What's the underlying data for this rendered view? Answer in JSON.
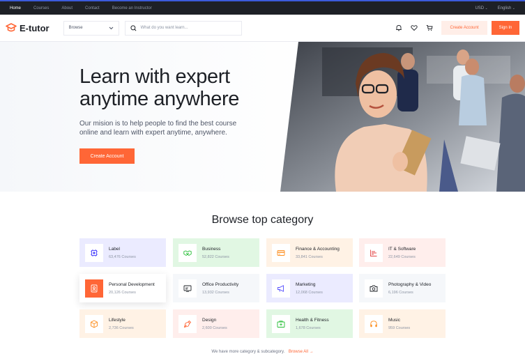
{
  "topbar": {
    "nav": [
      "Home",
      "Courses",
      "About",
      "Contact",
      "Become an Instructor"
    ],
    "currency": "USD",
    "language": "English"
  },
  "header": {
    "logo": "E-tutor",
    "browse": "Browse",
    "search_placeholder": "What do you want learn...",
    "create_account": "Create Account",
    "sign_in": "Sign In"
  },
  "hero": {
    "title_line1": "Learn with expert",
    "title_line2": "anytime anywhere",
    "subtitle": "Our mision is to help people to find the best course online and learn with expert anytime, anywhere.",
    "cta": "Create Account"
  },
  "categories": {
    "title": "Browse top category",
    "items": [
      {
        "name": "Label",
        "count": "63,476 Courses",
        "bg": "#ebebff",
        "color": "#564ffd",
        "icon": "cpu-icon"
      },
      {
        "name": "Business",
        "count": "52,822 Courses",
        "bg": "#e1f7e3",
        "color": "#23bd33",
        "icon": "handshake-icon"
      },
      {
        "name": "Finance & Accounting",
        "count": "33,841 Courses",
        "bg": "#fff2e5",
        "color": "#fd8e1f",
        "icon": "credit-card-icon"
      },
      {
        "name": "IT & Software",
        "count": "22,649 Courses",
        "bg": "#ffeeec",
        "color": "#e34444",
        "icon": "chart-bar-icon"
      },
      {
        "name": "Personal Development",
        "count": "20,126 Courses",
        "bg": "#ffffff",
        "color": "#ffffff",
        "icon": "id-card-icon"
      },
      {
        "name": "Office Productivity",
        "count": "13,932 Courses",
        "bg": "#f5f7fa",
        "color": "#1d2026",
        "icon": "monitor-icon"
      },
      {
        "name": "Marketing",
        "count": "12,068 Courses",
        "bg": "#ebebff",
        "color": "#564ffd",
        "icon": "megaphone-icon"
      },
      {
        "name": "Photography & Video",
        "count": "6,196 Courses",
        "bg": "#f5f7fa",
        "color": "#1d2026",
        "icon": "camera-icon"
      },
      {
        "name": "Lifestyle",
        "count": "2,736 Courses",
        "bg": "#fff2e5",
        "color": "#fd8e1f",
        "icon": "package-icon"
      },
      {
        "name": "Design",
        "count": "2,600 Courses",
        "bg": "#ffeeec",
        "color": "#ff6636",
        "icon": "pen-nib-icon"
      },
      {
        "name": "Health & Fitness",
        "count": "1,678 Courses",
        "bg": "#e1f7e3",
        "color": "#23bd33",
        "icon": "first-aid-icon"
      },
      {
        "name": "Music",
        "count": "959 Courses",
        "bg": "#fff2e5",
        "color": "#fd8e1f",
        "icon": "headphones-icon"
      }
    ]
  },
  "footer_note": {
    "text": "We have more category & subcategory.",
    "link": "Browse All →"
  }
}
